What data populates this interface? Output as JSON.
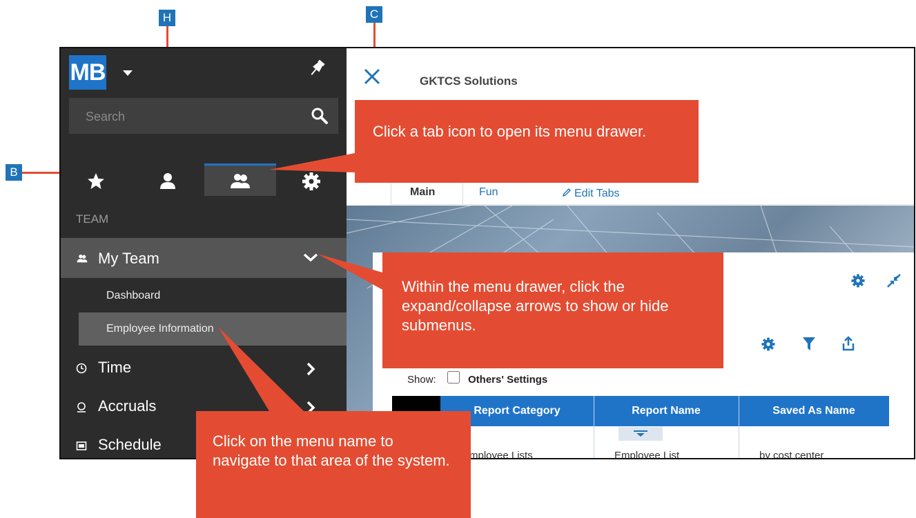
{
  "markers": {
    "h": "H",
    "c": "C",
    "b": "B"
  },
  "sidebar": {
    "badge": "MB",
    "search_placeholder": "Search",
    "section_label": "TEAM",
    "my_team_label": "My Team",
    "sub_items": [
      "Dashboard",
      "Employee Information"
    ],
    "nav_items": [
      "Time",
      "Accruals",
      "Schedule"
    ]
  },
  "main": {
    "company": "GKTCS Solutions",
    "tabs": [
      "Main",
      "Fun",
      "Edit Tabs"
    ],
    "show_label": "Show:",
    "others_settings_label": "Others' Settings",
    "grid": {
      "columns": [
        "Report Category",
        "Report Name",
        "Saved As Name"
      ],
      "row": [
        "Employee Lists",
        "Employee List",
        "by cost center"
      ]
    }
  },
  "callouts": {
    "tab_icon": "Click a tab icon to open its menu drawer.",
    "expand": "Within the menu drawer, click the expand/collapse arrows to show or hide submenus.",
    "menu_name": "Click on the menu name to navigate to that area of the system."
  },
  "colors": {
    "accent": "#1f74c8",
    "callout": "#e34c32",
    "sidebar": "#2c2c2c"
  },
  "icons": [
    "pin-icon",
    "search-icon",
    "star-icon",
    "person-icon",
    "team-icon",
    "gear-icon",
    "chevron-down-icon",
    "chevron-right-icon",
    "close-icon",
    "filter-icon",
    "export-icon",
    "collapse-icon",
    "clock-icon",
    "accruals-icon",
    "schedule-icon"
  ]
}
